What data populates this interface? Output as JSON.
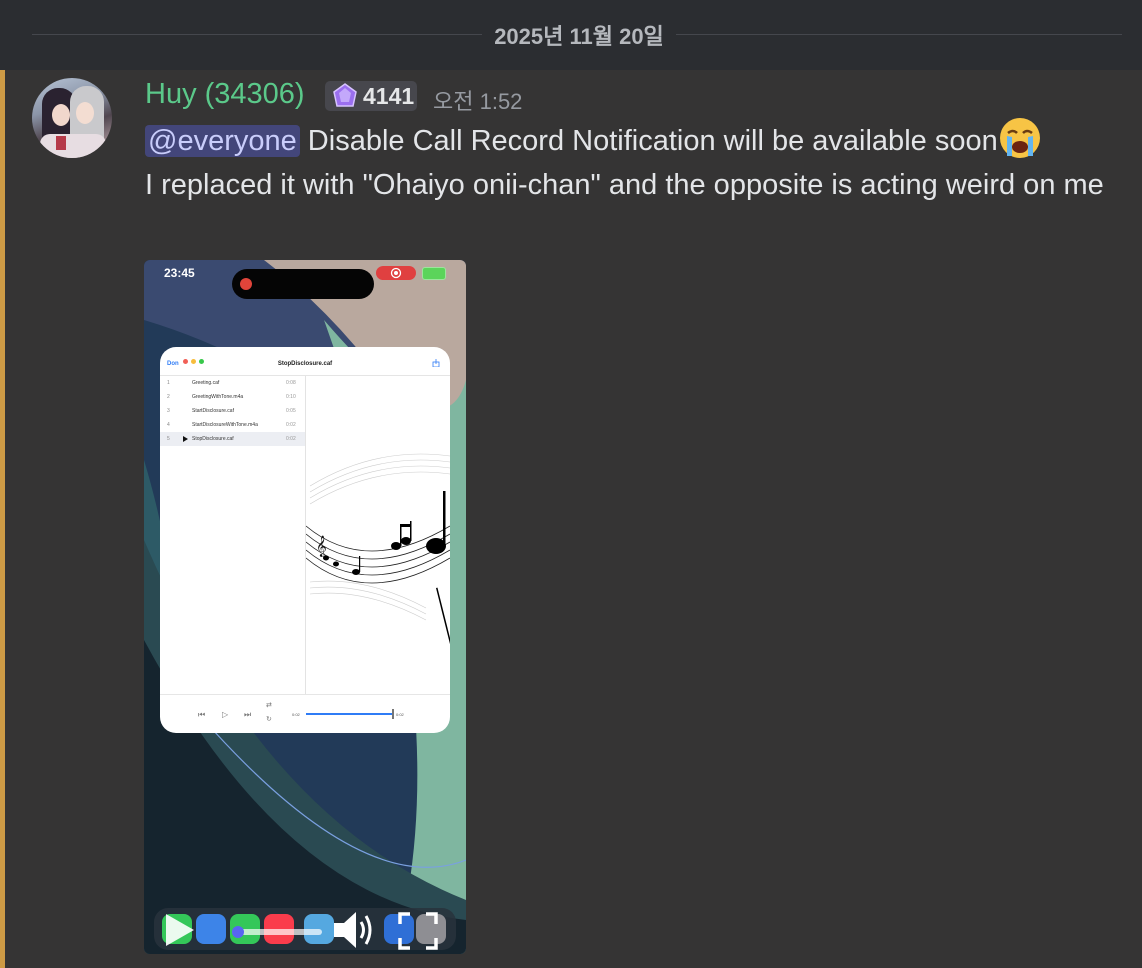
{
  "date_divider": {
    "label": "2025년 11월 20일"
  },
  "message": {
    "author": "Huy (34306)",
    "role_badge": {
      "icon": "purple-gem-icon",
      "count": "4141"
    },
    "timestamp": "오전 1:52",
    "mention": "@everyone",
    "line1_text": " Disable Call Record Notification will be available soon",
    "emoji": "loudly-crying-face-icon",
    "line2_text": "I replaced it with \"Ohaiyo onii-chan\" and the opposite is acting weird on me"
  },
  "attachment": {
    "status_time": "23:45",
    "window": {
      "done_label": "Don",
      "title": "StopDisclosure.caf",
      "tracks": [
        {
          "num": "1",
          "name": "Greeting.caf",
          "dur": "0:08"
        },
        {
          "num": "2",
          "name": "GreetingWithTone.m4a",
          "dur": "0:10"
        },
        {
          "num": "3",
          "name": "StartDisclosure.caf",
          "dur": "0:05"
        },
        {
          "num": "4",
          "name": "StartDisclosureWithTone.m4a",
          "dur": "0:02"
        },
        {
          "num": "5",
          "name": "StopDisclosure.caf",
          "dur": "0:02"
        }
      ],
      "elapsed": "0:02",
      "total": "0:02"
    }
  },
  "colors": {
    "accent_username": "#5bc98a",
    "mention_bar": "#cd9a45",
    "mention_bg": "#43467a"
  }
}
